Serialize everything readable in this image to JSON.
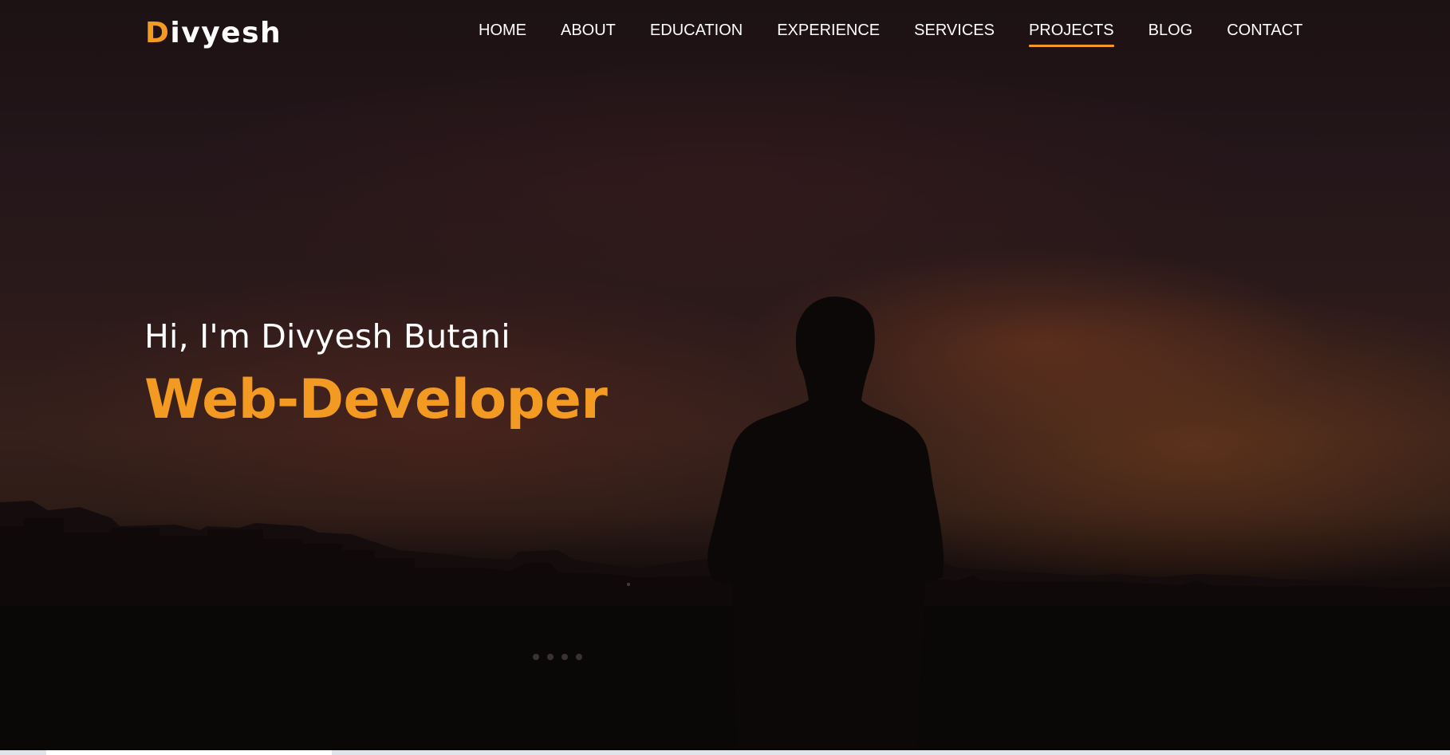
{
  "brand": {
    "first_letter": "D",
    "rest": "ivyesh",
    "accent_color": "#f39a22"
  },
  "nav": {
    "items": [
      {
        "label": "HOME",
        "active": false
      },
      {
        "label": "ABOUT",
        "active": false
      },
      {
        "label": "EDUCATION",
        "active": false
      },
      {
        "label": "EXPERIENCE",
        "active": false
      },
      {
        "label": "SERVICES",
        "active": false
      },
      {
        "label": "PROJECTS",
        "active": true
      },
      {
        "label": "BLOG",
        "active": false
      },
      {
        "label": "CONTACT",
        "active": false
      }
    ]
  },
  "hero": {
    "greeting": "Hi, I'm Divyesh Butani",
    "role": "Web-Developer",
    "role_color": "#f39a22",
    "background": "silhouette-at-dusk-image"
  }
}
